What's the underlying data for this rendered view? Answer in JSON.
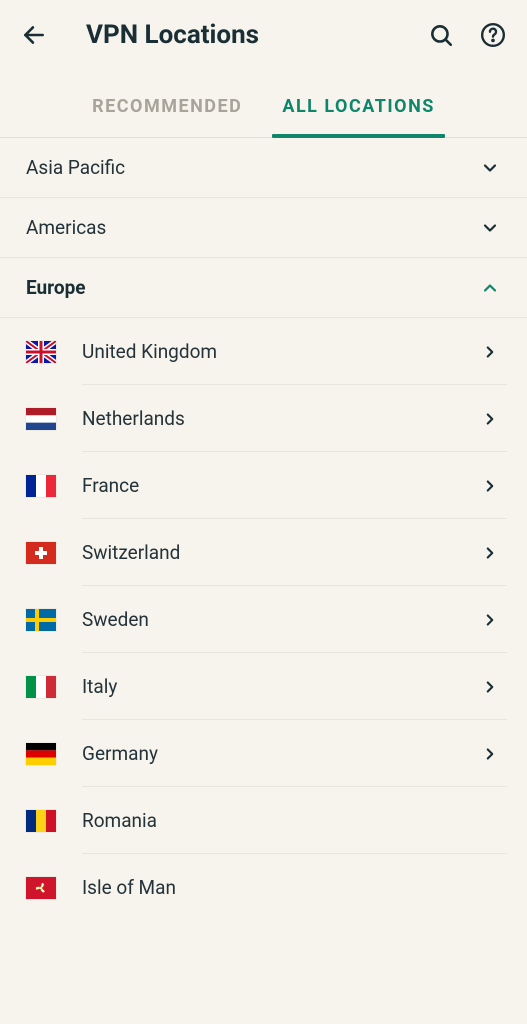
{
  "header": {
    "title": "VPN Locations"
  },
  "tabs": {
    "recommended": "RECOMMENDED",
    "all_locations": "ALL LOCATIONS",
    "active": "all_locations"
  },
  "regions": [
    {
      "label": "Asia Pacific",
      "expanded": false
    },
    {
      "label": "Americas",
      "expanded": false
    },
    {
      "label": "Europe",
      "expanded": true
    }
  ],
  "countries": [
    {
      "name": "United Kingdom",
      "flag": "gb",
      "chevron": true
    },
    {
      "name": "Netherlands",
      "flag": "nl",
      "chevron": true
    },
    {
      "name": "France",
      "flag": "fr",
      "chevron": true
    },
    {
      "name": "Switzerland",
      "flag": "ch",
      "chevron": true
    },
    {
      "name": "Sweden",
      "flag": "se",
      "chevron": true
    },
    {
      "name": "Italy",
      "flag": "it",
      "chevron": true
    },
    {
      "name": "Germany",
      "flag": "de",
      "chevron": true
    },
    {
      "name": "Romania",
      "flag": "ro",
      "chevron": false
    },
    {
      "name": "Isle of Man",
      "flag": "im",
      "chevron": false
    }
  ],
  "colors": {
    "accent": "#0f866c",
    "bg": "#f7f4ed",
    "text": "#1a2e35",
    "muted": "#a8a49a",
    "divider": "#e8e5dd"
  }
}
